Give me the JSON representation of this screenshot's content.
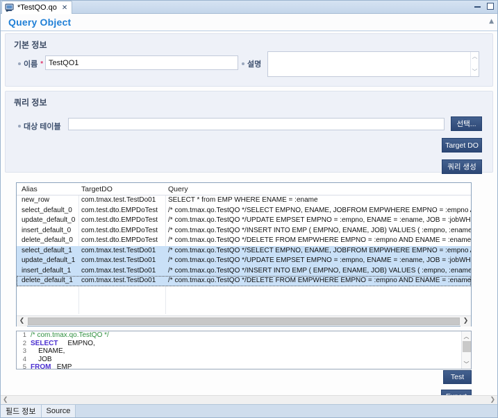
{
  "window": {
    "tab_label": "*TestQO.qo",
    "tab_close": "✕",
    "icon": "query-object-file-icon",
    "minimize": "minimize-icon",
    "maximize": "maximize-icon"
  },
  "header": {
    "title": "Query Object",
    "collapse_arrow": "▲"
  },
  "basic_section": {
    "title": "기본 정보",
    "name_label": "이름",
    "name_required": "*",
    "name_value": "TestQO1",
    "desc_label": "설명",
    "desc_value": "",
    "scroll_up": "︿",
    "scroll_down": "﹀"
  },
  "query_section": {
    "title": "쿼리 정보",
    "target_table_label": "대상 테이블",
    "target_table_value": "",
    "select_button": "선택...",
    "target_do_button": "Target DO",
    "generate_query_button": "쿼리 생성"
  },
  "table": {
    "columns": [
      "Alias",
      "TargetDO",
      "Query"
    ],
    "rows": [
      {
        "alias": "new_row",
        "targetdo": "com.tmax.test.TestDo01",
        "query": "SELECT * from EMP WHERE ENAME = :ename",
        "selected": false,
        "focused": false
      },
      {
        "alias": "select_default_0",
        "targetdo": "com.test.dto.EMPDoTest",
        "query": "/* com.tmax.qo.TestQO */SELECT     EMPNO,    ENAME,    JOBFROM   EMPWHERE       EMPNO = :empno   AND EN",
        "selected": false,
        "focused": false
      },
      {
        "alias": "update_default_0",
        "targetdo": "com.test.dto.EMPDoTest",
        "query": "/* com.tmax.qo.TestQO */UPDATE    EMPSET    EMPNO = :empno,    ENAME = :ename,    JOB = :jobWHERE    EMP..",
        "selected": false,
        "focused": false
      },
      {
        "alias": "insert_default_0",
        "targetdo": "com.test.dto.EMPDoTest",
        "query": "/* com.tmax.qo.TestQO */INSERT INTO EMP (    EMPNO,    ENAME,    JOB) VALUES (   :empno,   :ename,   :job)",
        "selected": false,
        "focused": false
      },
      {
        "alias": "delete_default_0",
        "targetdo": "com.test.dto.EMPDoTest",
        "query": "/* com.tmax.qo.TestQO */DELETE FROM EMPWHERE    EMPNO = :empno   AND ENAME = :ename   AND JOB = :jo",
        "selected": false,
        "focused": false
      },
      {
        "alias": "select_default_1",
        "targetdo": "com.tmax.test.TestDo01",
        "query": "/* com.tmax.qo.TestQO */SELECT     EMPNO,    ENAME,    JOBFROM   EMPWHERE       EMPNO = :empno   AND EN",
        "selected": true,
        "focused": false
      },
      {
        "alias": "update_default_1",
        "targetdo": "com.tmax.test.TestDo01",
        "query": "/* com.tmax.qo.TestQO */UPDATE    EMPSET    EMPNO = :empno,    ENAME = :ename,    JOB = :jobWHERE    EMP..",
        "selected": true,
        "focused": false
      },
      {
        "alias": "insert_default_1",
        "targetdo": "com.tmax.test.TestDo01",
        "query": "/* com.tmax.qo.TestQO */INSERT INTO EMP (    EMPNO,    ENAME,    JOB) VALUES (   :empno,   :ename,   :job)",
        "selected": true,
        "focused": false
      },
      {
        "alias": "delete_default_1",
        "targetdo": "com.tmax.test.TestDo01",
        "query": "/* com.tmax.qo.TestQO */DELETE FROM EMPWHERE    EMPNO = :empno   AND ENAME = :ename   AND JOB = :jo",
        "selected": true,
        "focused": true
      }
    ],
    "hscroll_left": "❮",
    "hscroll_right": "❯"
  },
  "sql_editor": {
    "lines": [
      {
        "no": "1",
        "comment": "/* com.tmax.qo.TestQO */",
        "keyword": "",
        "rest": ""
      },
      {
        "no": "2",
        "comment": "",
        "keyword": "SELECT",
        "rest": "     EMPNO,"
      },
      {
        "no": "3",
        "comment": "",
        "keyword": "",
        "rest": "    ENAME,"
      },
      {
        "no": "4",
        "comment": "",
        "keyword": "",
        "rest": "    JOB"
      },
      {
        "no": "5",
        "comment": "",
        "keyword": "FROM",
        "rest": "   EMP"
      }
    ],
    "scroll_up": "︿",
    "scroll_down": "﹀"
  },
  "actions": {
    "test_button": "Test",
    "export_button": "Export"
  },
  "bottom": {
    "tabs": [
      {
        "label": "필드 정보",
        "active": true
      },
      {
        "label": "Source",
        "active": false
      }
    ],
    "scroll_left": "❮",
    "scroll_right": "❯"
  },
  "colors": {
    "accent_blue": "#1f7fd6",
    "button_navy": "#2d4876",
    "selection_blue": "#c9e0f7",
    "section_bg": "#eef1f8",
    "tabstrip": "#c3d5ea",
    "sql_keyword": "#4a2fd0",
    "sql_comment": "#2f8f3f",
    "required_star": "#e0396b"
  }
}
